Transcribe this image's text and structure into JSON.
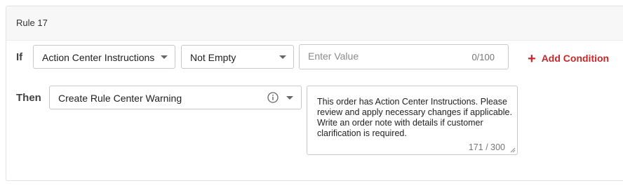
{
  "rule": {
    "title": "Rule 17",
    "if_label": "If",
    "then_label": "Then",
    "condition": {
      "field_select": "Action Center Instructions",
      "operator_select": "Not Empty",
      "value_placeholder": "Enter Value",
      "value": "",
      "value_counter": "0/100"
    },
    "add_condition_label": "Add Condition",
    "action": {
      "action_select": "Create Rule Center Warning",
      "message": "This order has Action Center Instructions. Please review and apply necessary changes if applicable. Write an order note with details if customer clarification is required.",
      "message_counter": "171 / 300"
    }
  },
  "icons": {
    "dropdown": "chevron-down-icon",
    "add": "plus-icon",
    "info": "info-icon",
    "resize": "resize-grip-icon"
  },
  "colors": {
    "accent_red": "#c62828",
    "header_bg": "#f7f7f8",
    "border": "#c9c9c9"
  }
}
